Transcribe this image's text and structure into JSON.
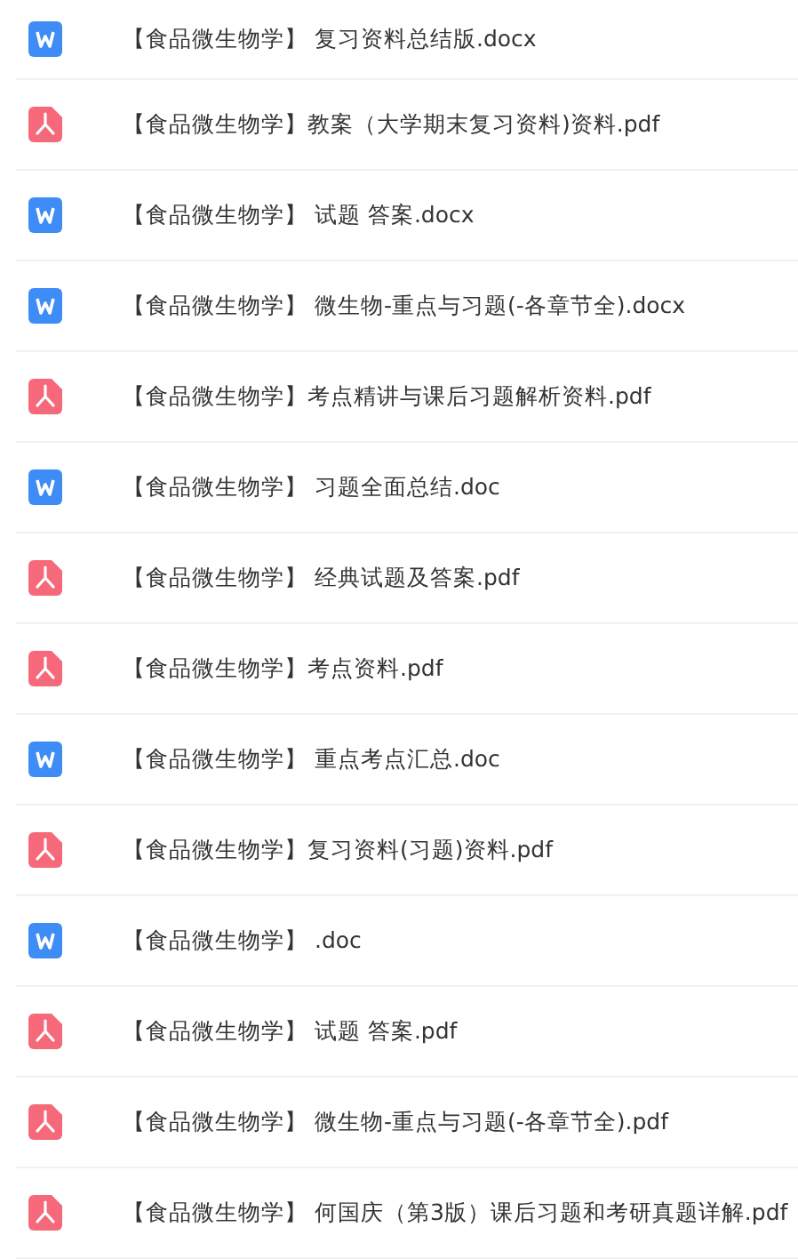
{
  "files": [
    {
      "kind": "word",
      "name": "【食品微生物学】 复习资料总结版.docx"
    },
    {
      "kind": "pdf",
      "name": "【食品微生物学】教案（大学期末复习资料)资料.pdf"
    },
    {
      "kind": "word",
      "name": "【食品微生物学】 试题 答案.docx"
    },
    {
      "kind": "word",
      "name": "【食品微生物学】 微生物-重点与习题(-各章节全).docx"
    },
    {
      "kind": "pdf",
      "name": "【食品微生物学】考点精讲与课后习题解析资料.pdf"
    },
    {
      "kind": "word",
      "name": "【食品微生物学】 习题全面总结.doc"
    },
    {
      "kind": "pdf",
      "name": "【食品微生物学】 经典试题及答案.pdf"
    },
    {
      "kind": "pdf",
      "name": "【食品微生物学】考点资料.pdf"
    },
    {
      "kind": "word",
      "name": "【食品微生物学】 重点考点汇总.doc"
    },
    {
      "kind": "pdf",
      "name": "【食品微生物学】复习资料(习题)资料.pdf"
    },
    {
      "kind": "word",
      "name": "【食品微生物学】 .doc"
    },
    {
      "kind": "pdf",
      "name": "【食品微生物学】 试题 答案.pdf"
    },
    {
      "kind": "pdf",
      "name": "【食品微生物学】 微生物-重点与习题(-各章节全).pdf"
    },
    {
      "kind": "pdf",
      "name": "【食品微生物学】 何国庆（第3版）课后习题和考研真题详解.pdf"
    }
  ]
}
